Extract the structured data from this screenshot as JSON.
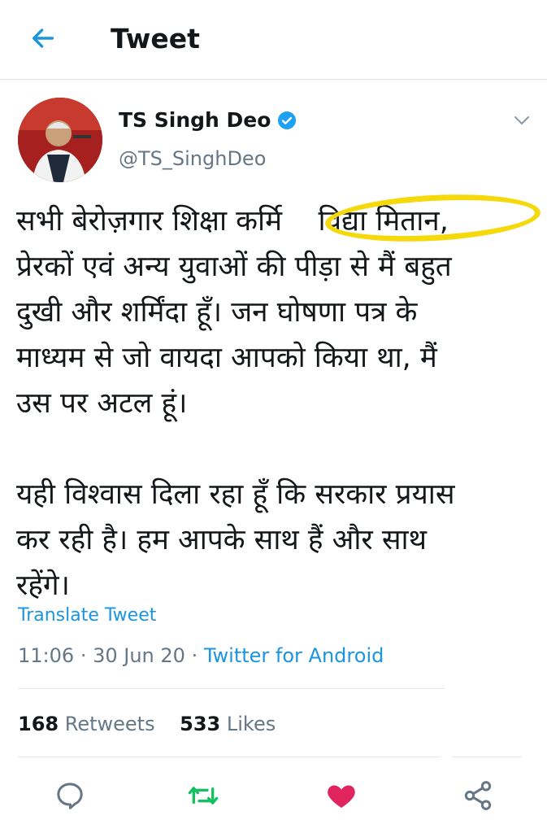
{
  "header": {
    "title": "Tweet",
    "back_icon": "arrow-left-icon"
  },
  "author": {
    "name": "TS Singh Deo",
    "handle": "@TS_SinghDeo",
    "verified": true
  },
  "tweet": {
    "text": "सभी बेरोज़गार शिक्षा कर्मि    विद्या मितान,\nप्रेरकों एवं अन्य युवाओं की पीड़ा से मैं बहुत\nदुखी और शर्मिंदा हूँ। जन घोषणा पत्र के\nमाध्यम से जो वायदा आपको किया था, मैं\nउस पर अटल हूं।\n\nयही विश्वास दिला रहा हूँ कि सरकार प्रयास\nकर रही है। हम आपके साथ हैं और साथ\nरहेंगे।",
    "translate_label": "Translate Tweet",
    "time": "11:06",
    "date": "30 Jun 20",
    "separator": "·",
    "source": "Twitter for Android"
  },
  "stats": {
    "retweets_count": "168",
    "retweets_label": "Retweets",
    "likes_count": "533",
    "likes_label": "Likes"
  },
  "actions": {
    "reply_icon": "reply-icon",
    "retweet_icon": "retweet-icon",
    "like_icon": "heart-icon",
    "share_icon": "share-icon"
  },
  "colors": {
    "link": "#1b95e0",
    "secondary": "#657786",
    "retweet": "#17bf63",
    "like": "#e0245e",
    "highlight": "#f5d90a"
  }
}
